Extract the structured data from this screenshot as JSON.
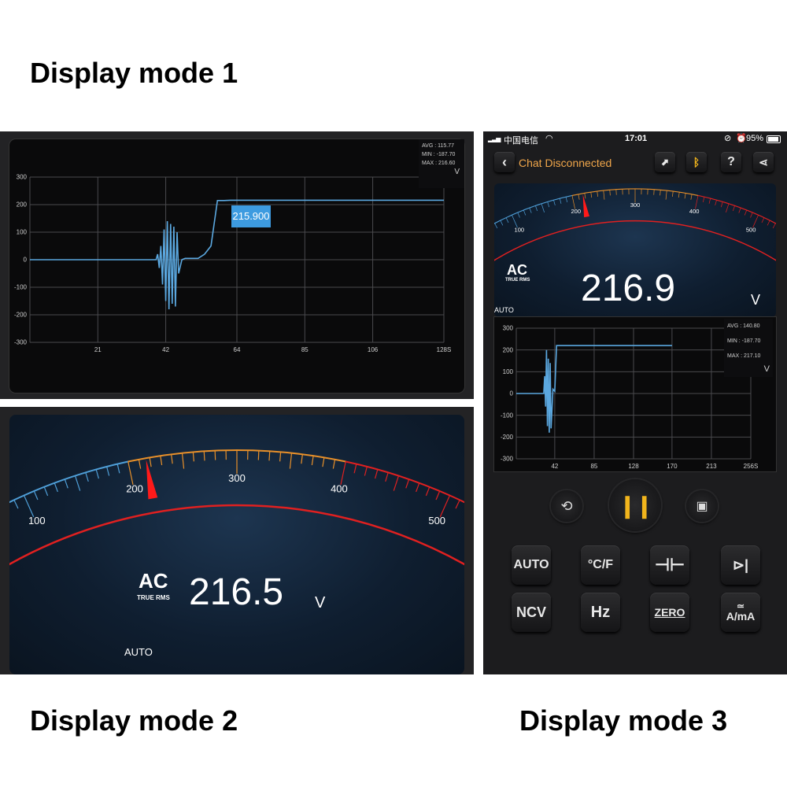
{
  "captions": {
    "mode1": "Display mode 1",
    "mode2": "Display mode 2",
    "mode3": "Display mode 3"
  },
  "mode1": {
    "stats": {
      "avg": "AVG : 115.77",
      "min": "MIN : -187.70",
      "max": "MAX : 216.60",
      "unit": "V"
    },
    "marker_value": "215.900"
  },
  "mode2": {
    "mode_label": "AC",
    "true_rms": "TRUE RMS",
    "reading": "216.5",
    "unit": "V",
    "range_mode": "AUTO"
  },
  "mode3": {
    "status_bar": {
      "carrier": "中国电信",
      "time": "17:01",
      "battery": "95%"
    },
    "header": {
      "title": "Chat Disconnected"
    },
    "gauge": {
      "mode_label": "AC",
      "true_rms": "TRUE RMS",
      "reading": "216.9",
      "unit": "V",
      "range_mode": "AUTO"
    },
    "stats": {
      "avg": "AVG : 140.80",
      "min": "MIN : -187.70",
      "max": "MAX : 217.10",
      "unit": "V"
    },
    "buttons": {
      "auto": "AUTO",
      "temp": "°C/F",
      "ncv": "NCV",
      "hz": "Hz",
      "zero": "ZERO",
      "amp": "A/mA"
    }
  },
  "colors": {
    "trace": "#5ba8e0",
    "marker_bg": "#3d9be0",
    "scale_blue": "#4f9fd8",
    "scale_orange": "#e8902a",
    "scale_red": "#e02020",
    "needle": "#ff1a1a",
    "pause_yellow": "#f2b51c",
    "title_orange": "#f0a64a"
  },
  "chart_data": [
    {
      "type": "line",
      "x_ticks": [
        "21",
        "42",
        "64",
        "85",
        "106",
        "128S"
      ],
      "y_ticks": [
        "300",
        "200",
        "100",
        "0",
        "-100",
        "-200",
        "-300"
      ],
      "xlim": [
        0,
        128
      ],
      "ylim": [
        -300,
        300
      ],
      "series": [
        {
          "x": [
            0,
            39,
            39.5,
            40,
            40.5,
            41,
            41.5,
            42,
            42.5,
            43,
            43.5,
            44,
            44.5,
            45,
            45.5,
            46,
            47,
            48,
            52,
            54,
            56,
            58,
            60,
            62,
            128
          ],
          "y": [
            0,
            0,
            20,
            -30,
            50,
            -90,
            110,
            -150,
            140,
            -180,
            130,
            -160,
            120,
            -170,
            100,
            -50,
            0,
            5,
            5,
            20,
            50,
            215,
            215,
            216,
            216
          ]
        }
      ]
    },
    {
      "type": "line",
      "x_ticks": [
        "42",
        "85",
        "128",
        "170",
        "213",
        "256S"
      ],
      "y_ticks": [
        "300",
        "200",
        "100",
        "0",
        "-100",
        "-200",
        "-300"
      ],
      "xlim": [
        0,
        256
      ],
      "ylim": [
        -300,
        300
      ],
      "series": [
        {
          "x": [
            0,
            30,
            31,
            32,
            33,
            34,
            35,
            36,
            37,
            38,
            40,
            42,
            44,
            46,
            48,
            170
          ],
          "y": [
            0,
            0,
            80,
            -60,
            200,
            -150,
            160,
            -180,
            140,
            -160,
            20,
            10,
            220,
            220,
            220,
            220
          ]
        }
      ]
    }
  ]
}
